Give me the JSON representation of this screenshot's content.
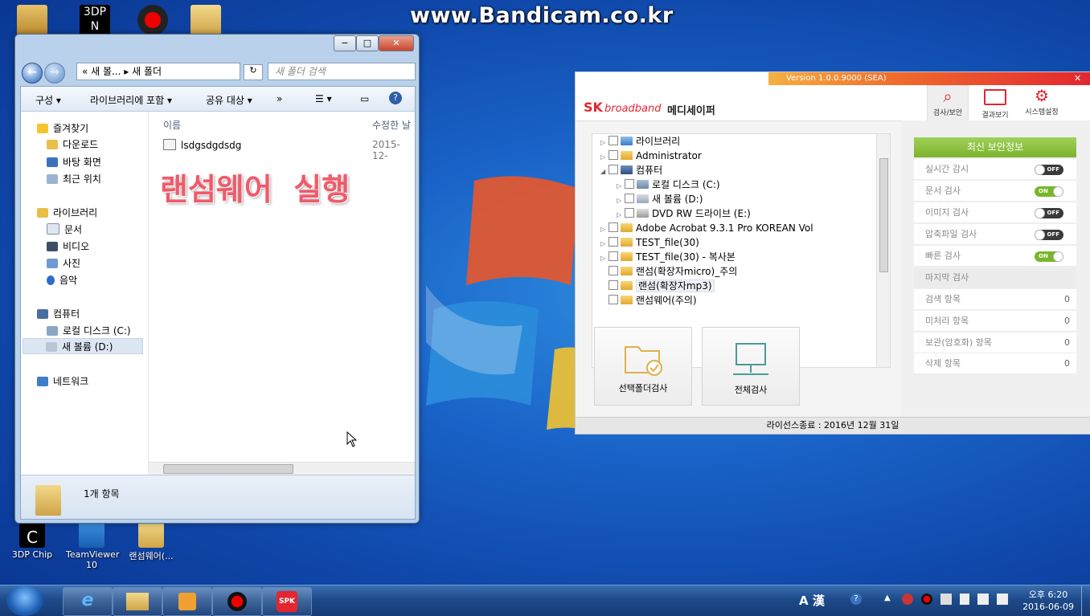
{
  "watermark": "www.Bandicam.co.kr",
  "desktop_icons": [
    {
      "label": "3DP Chip"
    },
    {
      "label": "TeamViewer 10"
    },
    {
      "label": "랜섬웨어(..."
    }
  ],
  "explorer": {
    "minimize": "−",
    "maximize": "□",
    "close": "✕",
    "breadcrumb": "« 새 볼... ▸ 새 폴더",
    "search_placeholder": "새 폴더 검색",
    "toolbar": {
      "organize": "구성 ▾",
      "include": "라이브러리에 포함 ▾",
      "share": "공유 대상 ▾",
      "more": "»"
    },
    "nav": {
      "favorites": "즐겨찾기",
      "downloads": "다운로드",
      "desktop": "바탕 화면",
      "recent": "최근 위치",
      "libraries": "라이브러리",
      "documents": "문서",
      "videos": "비디오",
      "pictures": "사진",
      "music": "음악",
      "computer": "컴퓨터",
      "local_disk": "로컬 디스크 (C:)",
      "new_volume": "새 볼륨 (D:)",
      "network": "네트워크"
    },
    "columns": {
      "name": "이름",
      "modified": "수정한 날"
    },
    "files": [
      {
        "name": "lsdgsdgdsdg",
        "modified": "2015-12-"
      }
    ],
    "overlay": "랜섬웨어  실행",
    "status_count": "1개 항목"
  },
  "sk": {
    "version": "Version 1.0.0.9000 (SEA)",
    "close": "✕",
    "brand_sk": "SK",
    "brand_bb": "broadband",
    "brand_app": "메디세이퍼",
    "tools": [
      {
        "label": "검사/보안"
      },
      {
        "label": "결과보기"
      },
      {
        "label": "시스템설정"
      }
    ],
    "tree": [
      "라이브러리",
      "Administrator",
      "컴퓨터",
      "로컬 디스크 (C:)",
      "새 볼륨 (D:)",
      "DVD RW 드라이브 (E:)",
      "Adobe Acrobat 9.3.1 Pro KOREAN Vol",
      "TEST_file(30)",
      "TEST_file(30) - 복사본",
      "랜섬(확장자micro)_주의",
      "랜섬(확장자mp3)",
      "랜섬웨어(주의)"
    ],
    "btn_folder": "선택폴더검사",
    "btn_full": "전체검사",
    "security_header": "최신 보안정보",
    "settings": [
      {
        "label": "실시간 감시",
        "state": "OFF"
      },
      {
        "label": "문서 검사",
        "state": "ON"
      },
      {
        "label": "이미지 검사",
        "state": "OFF"
      },
      {
        "label": "압축파일 검사",
        "state": "OFF"
      },
      {
        "label": "빠른 검사",
        "state": "ON"
      }
    ],
    "last_scan": "마지막 검사",
    "stats": [
      {
        "label": "검색 항목",
        "value": "0"
      },
      {
        "label": "미처리 항목",
        "value": "0"
      },
      {
        "label": "보관(암호화) 항목",
        "value": "0"
      },
      {
        "label": "삭제 항목",
        "value": "0"
      }
    ],
    "license": "라이선스종료 : 2016년 12월 31일"
  },
  "taskbar": {
    "tray_lang": "A 漢",
    "time": "오후 6:20",
    "date": "2016-06-09"
  },
  "colors": {
    "sk_green": "#8cc63f",
    "sk_red": "#e3262f",
    "overlay_text": "#f05a6a"
  }
}
